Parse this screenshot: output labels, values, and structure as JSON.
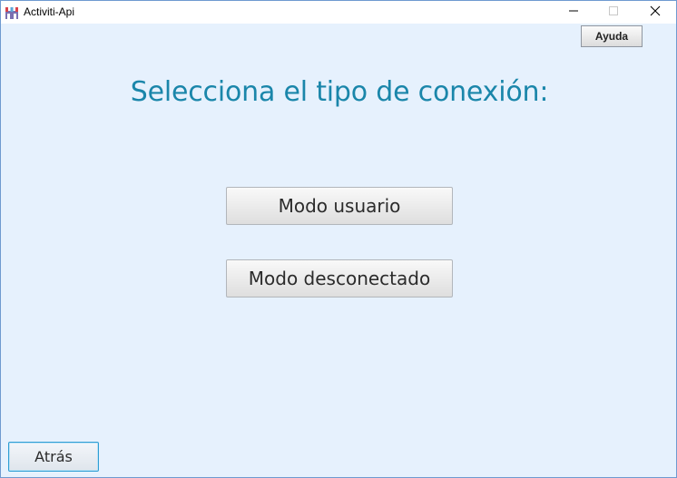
{
  "window": {
    "title": "Activiti-Api",
    "app_icon": "activiti-app-icon",
    "controls": {
      "minimize_icon": "minimize-icon",
      "maximize_icon": "maximize-icon",
      "close_icon": "close-icon"
    }
  },
  "toolbar": {
    "help_label": "Ayuda"
  },
  "main": {
    "heading": "Selecciona el tipo de conexión:",
    "user_mode_label": "Modo usuario",
    "offline_mode_label": "Modo desconectado"
  },
  "footer": {
    "back_label": "Atrás"
  },
  "colors": {
    "background": "#e6f1fd",
    "heading": "#1a86aa",
    "focus_border": "#2e9ed3"
  }
}
